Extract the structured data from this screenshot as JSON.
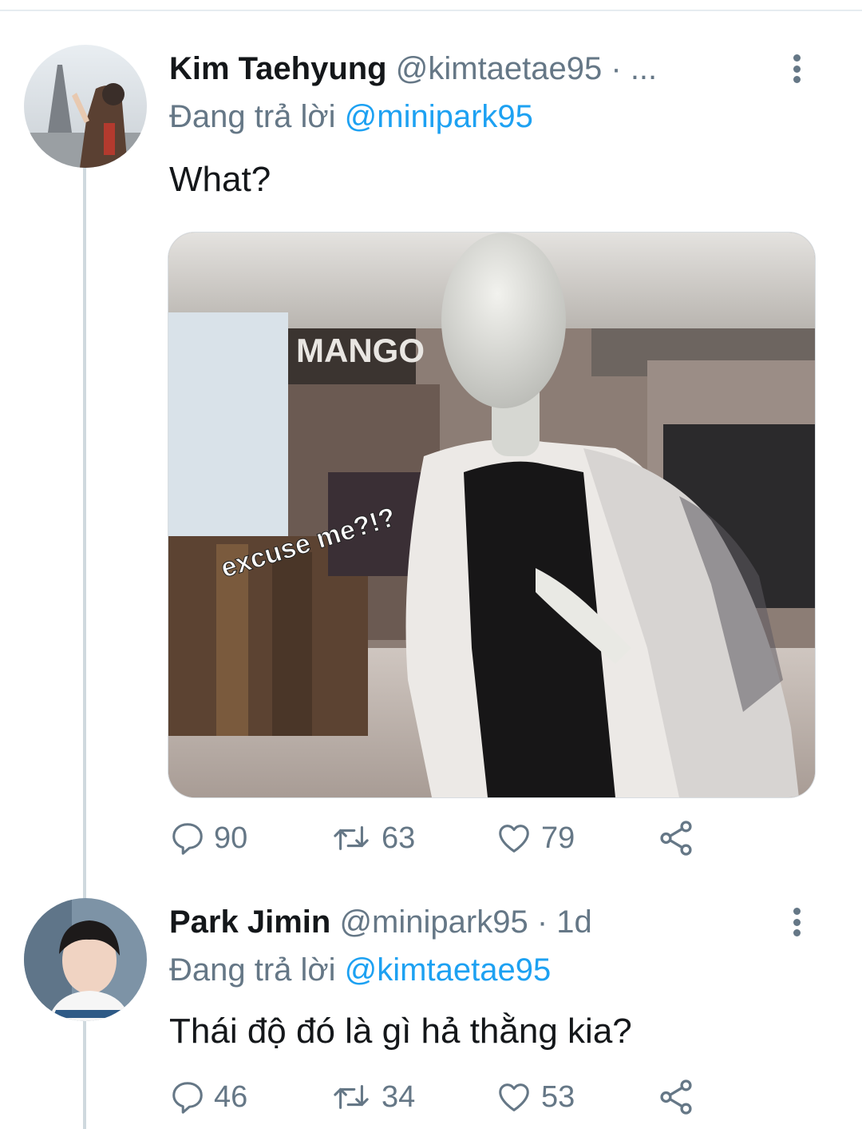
{
  "tweets": [
    {
      "display_name": "Kim Taehyung",
      "handle": "@kimtaetae95 · ...",
      "reply_prefix": "Đang trả lời",
      "reply_to": "@minipark95",
      "text": "What?",
      "media": {
        "store_sign": "MANGO",
        "caption": "excuse me?!?"
      },
      "replies": "90",
      "retweets": "63",
      "likes": "79"
    },
    {
      "display_name": "Park Jimin",
      "handle": "@minipark95 · 1d",
      "reply_prefix": "Đang trả lời",
      "reply_to": "@kimtaetae95",
      "text": "Thái độ đó là gì hả thằng kia?",
      "replies": "46",
      "retweets": "34",
      "likes": "53"
    }
  ],
  "icons": {
    "reply": "reply-icon",
    "retweet": "retweet-icon",
    "like": "heart-icon",
    "share": "share-icon",
    "more": "more-vertical-icon"
  },
  "colors": {
    "link": "#1da1f2",
    "muted": "#657786",
    "text": "#14171a",
    "thread_line": "#cfd9de"
  }
}
